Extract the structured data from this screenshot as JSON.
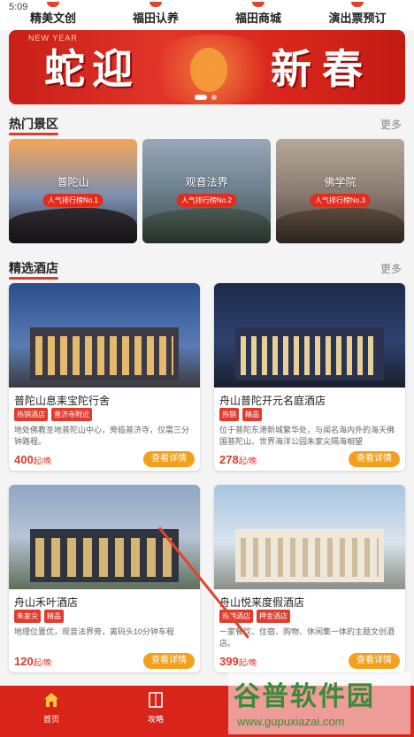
{
  "status": {
    "time": "5:09"
  },
  "top_nav": [
    {
      "label": "精美文创"
    },
    {
      "label": "福田认养"
    },
    {
      "label": "福田商城"
    },
    {
      "label": "演出票预订"
    }
  ],
  "banner": {
    "tag": "NEW YEAR",
    "title_left": "蛇迎",
    "title_right": "新春"
  },
  "hot_spots": {
    "title": "热门景区",
    "more": "更多",
    "items": [
      {
        "name": "普陀山",
        "rank": "人气排行榜No.1"
      },
      {
        "name": "观音法界",
        "rank": "人气排行榜No.2"
      },
      {
        "name": "佛学院",
        "rank": "人气排行榜No.3"
      }
    ]
  },
  "hotels": {
    "title": "精选酒店",
    "more": "更多",
    "items": [
      {
        "name": "普陀山息耒宝陀行舍",
        "tags": [
          "热销酒店",
          "普济寺附近"
        ],
        "desc": "地处佛教圣地普陀山中心，旁临普济寺，仅需三分钟路程。",
        "price": "400",
        "unit": "起/晚",
        "button": "查看详情"
      },
      {
        "name": "舟山普陀开元名庭酒店",
        "tags": [
          "热销",
          "精品"
        ],
        "desc": "位于普陀东港新城繁华处，与闻名海内外的海天佛国普陀山、世界海洋公园朱家尖隔海相望",
        "price": "278",
        "unit": "起/晚",
        "button": "查看详情"
      },
      {
        "name": "舟山禾叶酒店",
        "tags": [
          "朱家尖",
          "精品"
        ],
        "desc": "地理位置优，观音法界旁，离码头10分钟车程",
        "price": "120",
        "unit": "起/晚",
        "button": "查看详情"
      },
      {
        "name": "舟山悦来度假酒店",
        "tags": [
          "热销酒店",
          "押金酒店"
        ],
        "desc": "一家餐饮、住宿、购物、休闲集一体的主题文创酒店。",
        "price": "399",
        "unit": "起/晚",
        "button": "查看详情"
      }
    ]
  },
  "tab_bar": [
    {
      "label": "首页"
    },
    {
      "label": "攻略"
    }
  ],
  "watermark": {
    "line1": "谷普软件园",
    "line2": "www.gupuxiazai.com"
  },
  "colors": {
    "brand_red": "#d92519",
    "button_orange": "#f2a11c",
    "tag_red": "#e23b2d"
  }
}
